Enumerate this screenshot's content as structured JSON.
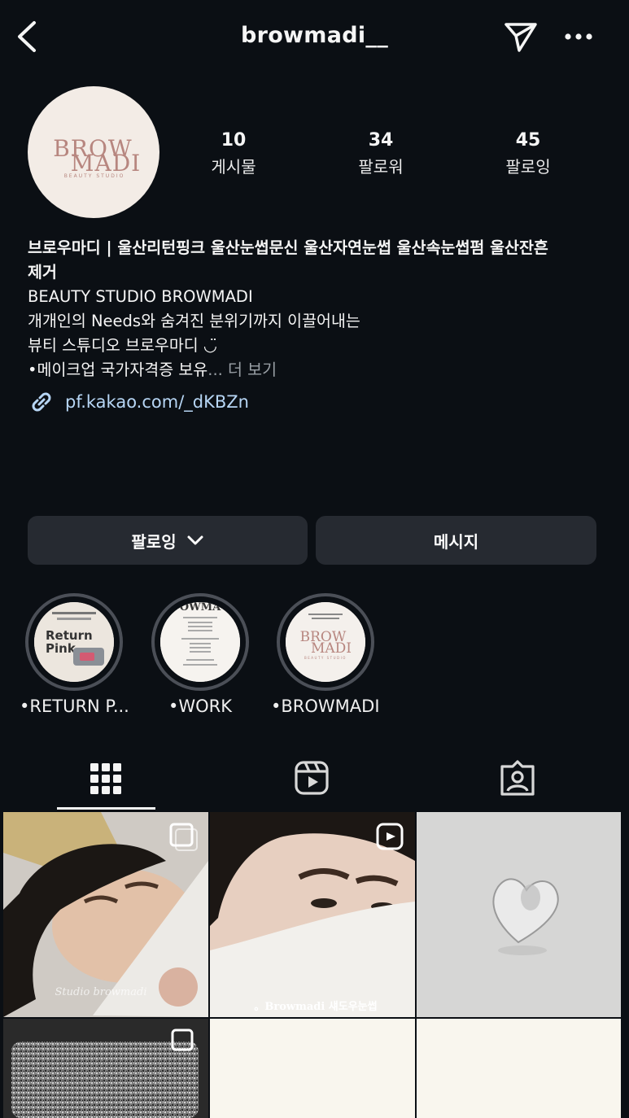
{
  "header": {
    "username": "browmadi__",
    "back_icon": "chevron-left-icon",
    "send_icon": "paper-plane-icon",
    "more_icon": "more-horizontal-icon"
  },
  "profile": {
    "avatar_logo": "BROW MADI",
    "avatar_sub": "BEAUTY STUDIO",
    "stats": [
      {
        "value": "10",
        "label": "게시물"
      },
      {
        "value": "34",
        "label": "팔로워"
      },
      {
        "value": "45",
        "label": "팔로잉"
      }
    ],
    "bio": {
      "name_line1": "브로우마디 | 울산리턴핑크 울산눈썹문신 울산자연눈썹 울산속눈썹펌 울산잔흔",
      "name_line2": "제거",
      "line1": "BEAUTY STUDIO BROWMADI",
      "line2": "개개인의 Needs와 숨겨진 분위기까지 이끌어내는",
      "line3": "뷰티 스튜디오 브로우마디 ◡̈",
      "line4": "•메이크업 국가자격증 보유",
      "more": "... 더 보기"
    },
    "link": "pf.kakao.com/_dKBZn"
  },
  "actions": {
    "following_label": "팔로잉",
    "message_label": "메시지"
  },
  "highlights": [
    {
      "label": "•RETURN P...",
      "cover_title": "Return Pink"
    },
    {
      "label": "•WORK",
      "cover_title": "BROWMADI"
    },
    {
      "label": "•BROWMADI",
      "cover_title": "BROW MADI"
    }
  ],
  "tabs": [
    {
      "icon": "grid-icon",
      "active": true
    },
    {
      "icon": "reels-icon",
      "active": false
    },
    {
      "icon": "tagged-icon",
      "active": false
    }
  ],
  "posts": [
    {
      "caption": "Studio browmadi",
      "badge": "carousel-icon"
    },
    {
      "caption": "。Browmadi 섀도우눈썹",
      "badge": "reels-icon"
    },
    {
      "caption": "",
      "badge": ""
    },
    {
      "caption": "",
      "badge": "carousel-icon"
    },
    {
      "caption": "",
      "badge": ""
    },
    {
      "caption": "",
      "badge": ""
    }
  ],
  "colors": {
    "background": "#0b0f14",
    "button": "#262a31",
    "link": "#b7d6f5",
    "brand": "#b7867f"
  }
}
